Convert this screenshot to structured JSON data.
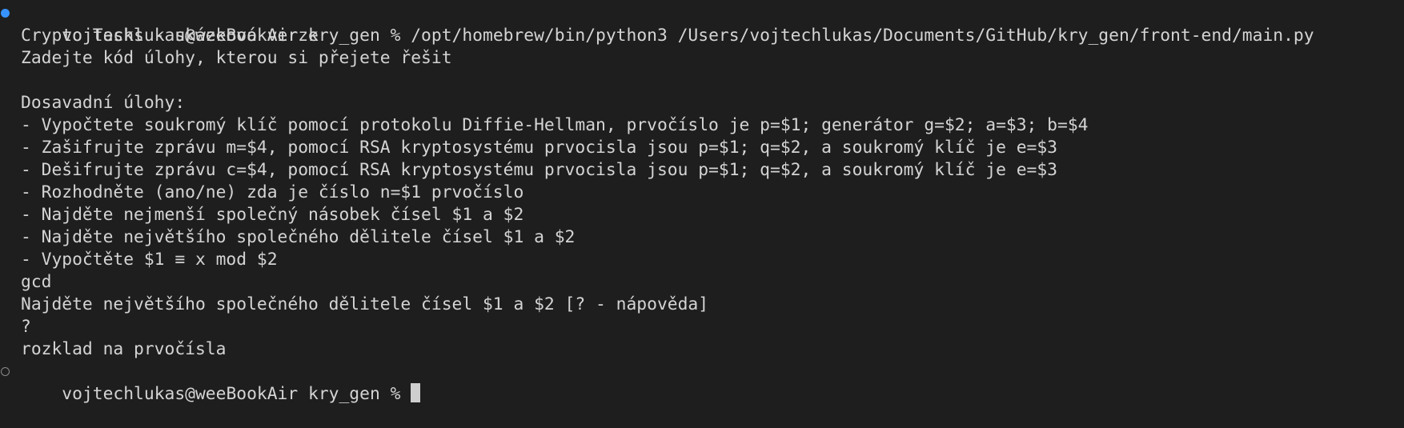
{
  "colors": {
    "background": "#1e1e1e",
    "text": "#d4d4d4",
    "marker_success": "#3794ff",
    "marker_pending": "#8a8a8a",
    "cursor": "#cfcfcf"
  },
  "terminal": {
    "command_line": "vojtechlukas@weeBookAir kry_gen % /opt/homebrew/bin/python3 /Users/vojtechlukas/Documents/GitHub/kry_gen/front-end/main.py",
    "title": "Crypto Tasks - ukázková verze",
    "instruction": "Zadejte kód úlohy, kterou si přejete řešit",
    "tasks_heading": "Dosavadní úlohy:",
    "tasks": [
      "- Vypočtete soukromý klíč pomocí protokolu Diffie-Hellman, prvočíslo je p=$1; generátor g=$2; a=$3; b=$4",
      "- Zašifrujte zprávu m=$4, pomocí RSA kryptosystému prvocisla jsou p=$1; q=$2, a soukromý klíč je e=$3",
      "- Dešifrujte zprávu c=$4, pomocí RSA kryptosystému prvocisla jsou p=$1; q=$2, a soukromý klíč je e=$3",
      "- Rozhodněte (ano/ne) zda je číslo n=$1 prvočíslo",
      "- Najděte nejmenší společný násobek čísel $1 a $2",
      "- Najděte největšího společného dělitele čísel $1 a $2",
      "- Vypočtěte $1 ≡ x mod $2"
    ],
    "user_input_1": "gcd",
    "selected_task": "Najděte největšího společného dělitele čísel $1 a $2 [? - nápověda]",
    "user_input_2": "?",
    "hint": "rozklad na prvočísla",
    "prompt": "vojtechlukas@weeBookAir kry_gen % "
  }
}
